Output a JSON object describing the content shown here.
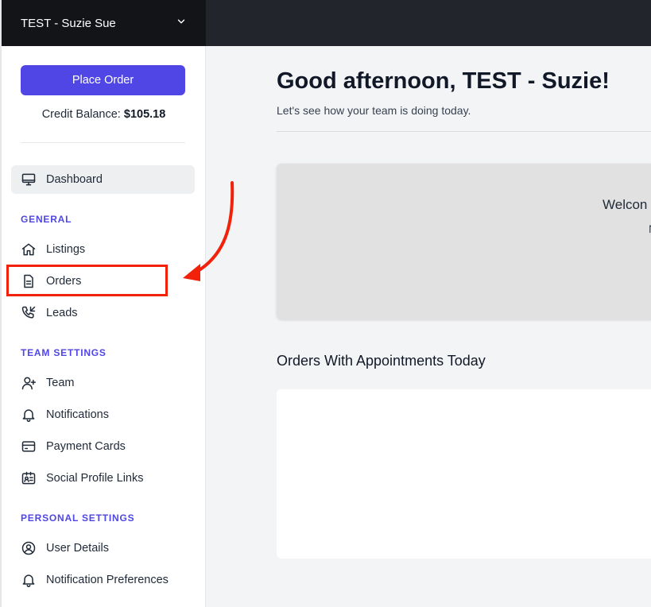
{
  "account": {
    "name": "TEST - Suzie Sue"
  },
  "sidebar": {
    "place_order_label": "Place Order",
    "credit_label": "Credit Balance: ",
    "credit_value": "$105.18",
    "dashboard": {
      "label": "Dashboard",
      "icon": "monitor-icon"
    },
    "sections": {
      "general": "GENERAL",
      "team_settings": "TEAM SETTINGS",
      "personal_settings": "PERSONAL SETTINGS"
    },
    "general_items": [
      {
        "label": "Listings",
        "icon": "home-icon"
      },
      {
        "label": "Orders",
        "icon": "document-icon"
      },
      {
        "label": "Leads",
        "icon": "phone-incoming-icon"
      }
    ],
    "team_items": [
      {
        "label": "Team",
        "icon": "user-plus-icon"
      },
      {
        "label": "Notifications",
        "icon": "bell-icon"
      },
      {
        "label": "Payment Cards",
        "icon": "credit-card-icon"
      },
      {
        "label": "Social Profile Links",
        "icon": "id-card-icon"
      }
    ],
    "personal_items": [
      {
        "label": "User Details",
        "icon": "user-circle-icon"
      },
      {
        "label": "Notification Preferences",
        "icon": "bell-icon"
      }
    ]
  },
  "main": {
    "greeting": "Good afternoon, TEST - Suzie!",
    "subtitle": "Let's see how your team is doing today.",
    "welcome_title": "Welcon",
    "welcome_sub": "N",
    "orders_title": "Orders With Appointments Today"
  },
  "colors": {
    "accent": "#4f46e5",
    "topbar": "#22252c",
    "account_bg": "#121417",
    "annotation": "#f2210a"
  }
}
